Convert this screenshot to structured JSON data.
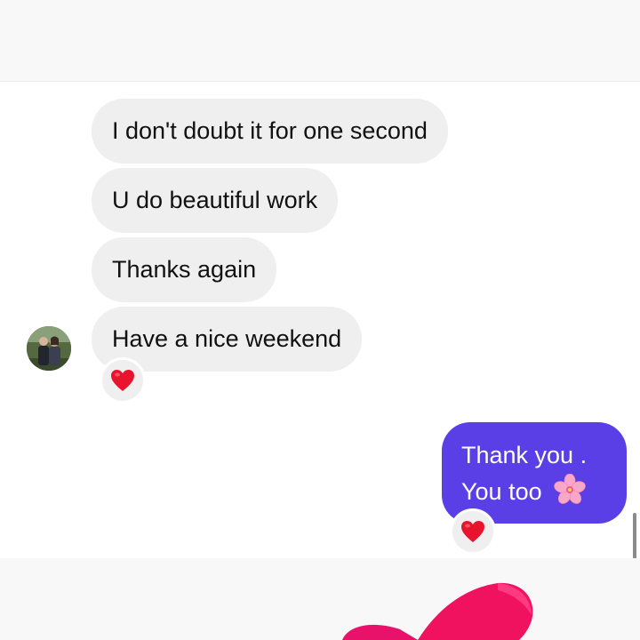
{
  "header": {},
  "messages": {
    "incoming": [
      {
        "text": "I don't doubt it for one second"
      },
      {
        "text": "U do beautiful work"
      },
      {
        "text": "Thanks again"
      },
      {
        "text": "Have a nice weekend",
        "reaction": "red-heart-icon"
      }
    ],
    "outgoing": [
      {
        "lines": [
          "Thank you .",
          "You too"
        ],
        "emoji": "cherry-blossom-icon",
        "reaction": "red-heart-icon"
      }
    ]
  },
  "colors": {
    "outgoing_bubble": "#5b3fe6",
    "incoming_bubble": "#efeff0",
    "heart": "#e8142d"
  },
  "composer": {
    "decoration": "large-heart-sticker-icon"
  }
}
